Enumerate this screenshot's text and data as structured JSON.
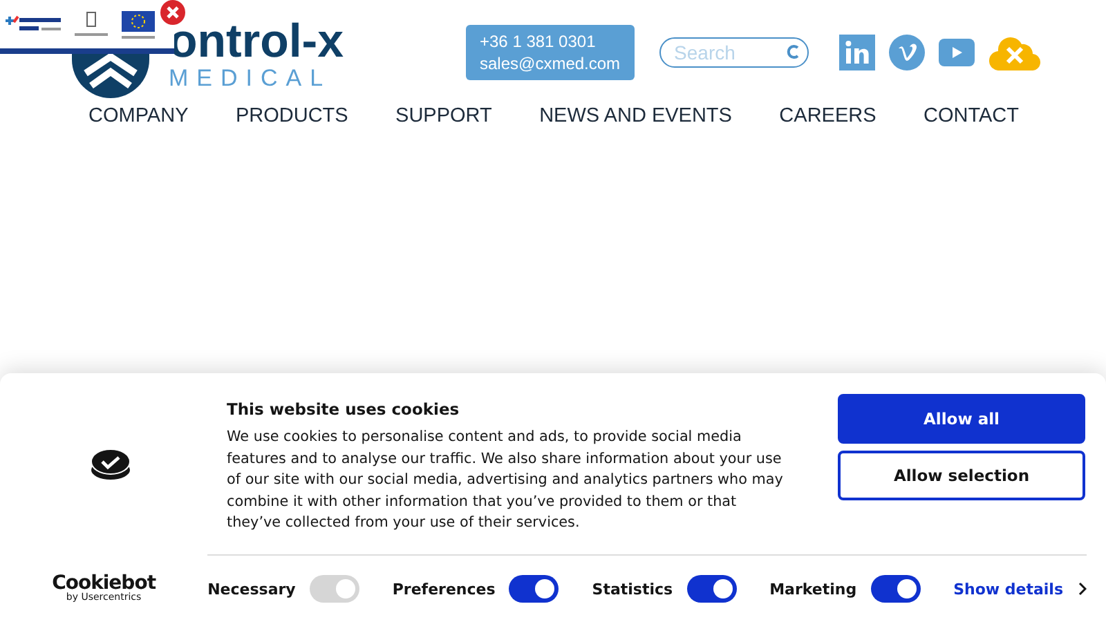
{
  "header": {
    "logo": {
      "word": "ontrol-x",
      "sub": "MEDICAL"
    },
    "contact": {
      "phone": "+36 1 381 0301",
      "email": "sales@cxmed.com"
    },
    "search": {
      "placeholder": "Search"
    }
  },
  "nav": [
    "COMPANY",
    "PRODUCTS",
    "SUPPORT",
    "NEWS AND EVENTS",
    "CAREERS",
    "CONTACT"
  ],
  "cookie_dialog": {
    "title": "This website uses cookies",
    "text": "We use cookies to personalise content and ads, to provide social media features and to analyse our traffic. We also share information about your use of our site with our social media, advertising and analytics partners who may combine it with other information that you’ve provided to them or that they’ve collected from your use of their services.",
    "buttons": [
      "Allow all",
      "Allow selection"
    ],
    "brand": {
      "name": "Cookiebot",
      "sub": "by Usercentrics"
    },
    "toggles": [
      {
        "label": "Necessary",
        "checked": true,
        "disabled": true
      },
      {
        "label": "Preferences",
        "checked": true,
        "disabled": false
      },
      {
        "label": "Statistics",
        "checked": true,
        "disabled": false
      },
      {
        "label": "Marketing",
        "checked": true,
        "disabled": false
      }
    ],
    "details_link": "Show details"
  }
}
